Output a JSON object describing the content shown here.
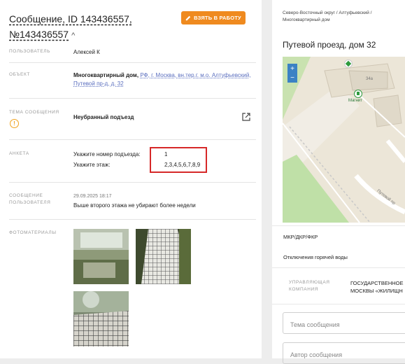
{
  "left": {
    "title_line1": "Сообщение, ID 143436557,",
    "title_line2": "№143436557",
    "take_button": "ВЗЯТЬ В РАБОТУ",
    "user_label": "ПОЛЬЗОВАТЕЛЬ",
    "user_value": "Алексей К",
    "object_label": "ОБЪЕКТ",
    "object_bold": "Многоквартирный дом,",
    "object_link1": "РФ, г. Москва, вн.тер.г. м.о. Алтуфьевский,",
    "object_link2": "Путевой пр-д, д. 32",
    "topic_label": "ТЕМА СООБЩЕНИЯ",
    "topic_value": "Неубранный подъезд",
    "form_label": "АНКЕТА",
    "q1": "Укажите номер подъезда:",
    "a1": "1",
    "q2": "Укажите этаж:",
    "a2": "2,3,4,5,6,7,8,9",
    "msg_label_1": "СООБЩЕНИЕ",
    "msg_label_2": "ПОЛЬЗОВАТЕЛЯ",
    "msg_date": "29.09.2025 18:17",
    "msg_text": "Выше второго этажа не убирают более недели",
    "photos_label": "ФОТОМАТЕРИАЛЫ"
  },
  "right": {
    "breadcrumb": "Северо-Восточный округ / Алтуфьевский / Многоквартирный дом",
    "address": "Путевой проезд, дом 32",
    "map_zoom_in": "+",
    "map_zoom_out": "−",
    "map_house": "34а",
    "map_shop": "Магнит",
    "map_street": "Путевой пр",
    "section1": "МКР/ДКР/ФКР",
    "section2": "Отключения горячей воды",
    "uk_label_1": "УПРАВЛЯЮЩАЯ",
    "uk_label_2": "КОМПАНИЯ",
    "uk_value_1": "ГОСУДАРСТВЕННОЕ",
    "uk_value_2": "МОСКВЫ «ЖИЛИЩН",
    "topic_placeholder": "Тема сообщения",
    "author_placeholder": "Автор сообщения"
  },
  "colors": {
    "accent_orange": "#ef8a1f",
    "link_blue": "#5b6fbf",
    "highlight_red": "#d62828",
    "map_zoom_blue": "#3b82c4"
  },
  "icons": [
    "pencil-icon",
    "chevron-up-icon",
    "warning-icon",
    "external-link-icon",
    "map-marker-icon",
    "shop-marker-icon"
  ]
}
